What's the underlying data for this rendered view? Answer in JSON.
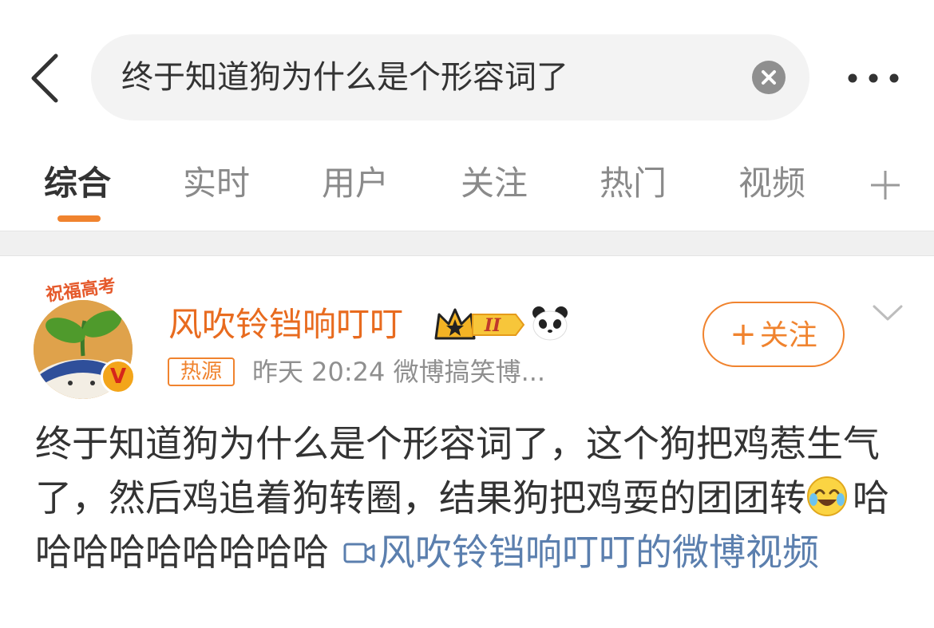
{
  "search": {
    "query": "终于知道狗为什么是个形容词了"
  },
  "tabs": [
    {
      "label": "综合",
      "active": true
    },
    {
      "label": "实时",
      "active": false
    },
    {
      "label": "用户",
      "active": false
    },
    {
      "label": "关注",
      "active": false
    },
    {
      "label": "热门",
      "active": false
    },
    {
      "label": "视频",
      "active": false
    }
  ],
  "post": {
    "avatar_badge_text": "祝福高考",
    "username": "风吹铃铛响叮叮",
    "level_badge": "II",
    "source_tag": "热源",
    "meta": "昨天 20:24  微博搞笑博...",
    "follow_label": "关注",
    "text_main": "终于知道狗为什么是个形容词了，这个狗把鸡惹生气了，然后鸡追着狗转圈，结果狗把鸡耍的团团转",
    "text_after_emoji": "哈哈哈哈哈哈哈哈哈",
    "video_link": "风吹铃铛响叮叮的微博视频"
  },
  "colors": {
    "accent_orange": "#f0832e",
    "username_orange": "#e86b1f",
    "link_blue": "#5b7fae",
    "muted_gray": "#8f8f8f"
  },
  "icons": [
    "back-arrow-icon",
    "clear-icon",
    "more-icon",
    "add-tab-icon",
    "crown-icon",
    "panda-icon",
    "verified-icon",
    "chevron-down-icon",
    "laughing-emoji-icon",
    "video-icon"
  ]
}
